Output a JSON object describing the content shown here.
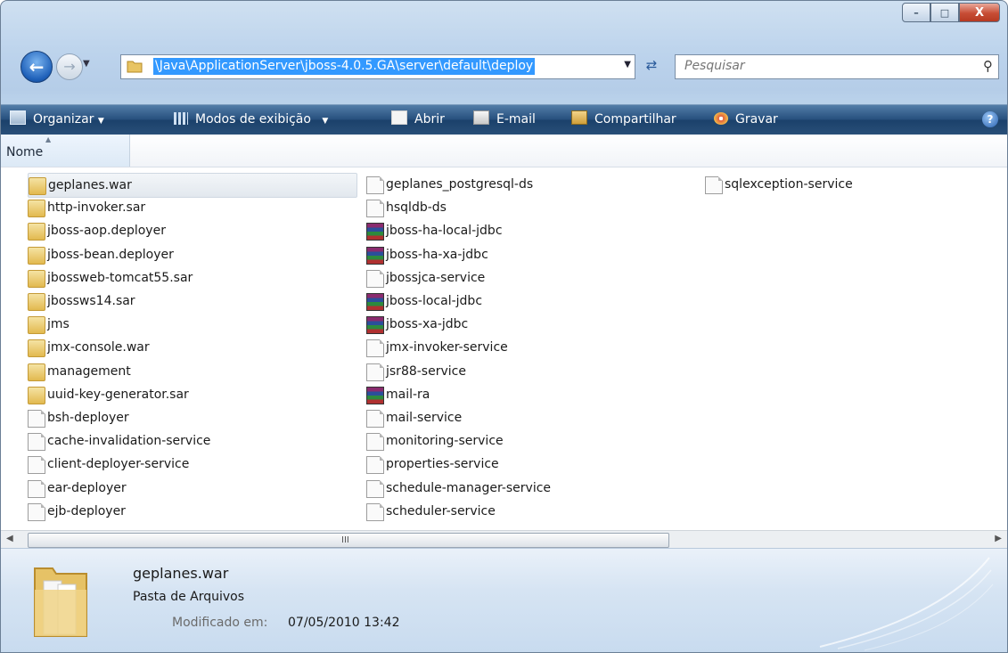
{
  "window": {
    "minimize_glyph": "–",
    "maximize_glyph": "□",
    "close_glyph": "X"
  },
  "address": {
    "path": "\\Java\\ApplicationServer\\jboss-4.0.5.GA\\server\\default\\deploy",
    "search_placeholder": "Pesquisar"
  },
  "toolbar": {
    "organizar": "Organizar",
    "modos": "Modos de exibição",
    "abrir": "Abrir",
    "email": "E-mail",
    "compartilhar": "Compartilhar",
    "gravar": "Gravar",
    "help": "?"
  },
  "columns": {
    "name": "Nome"
  },
  "files": {
    "col1": [
      {
        "name": "geplanes.war",
        "type": "folder"
      },
      {
        "name": "http-invoker.sar",
        "type": "folder"
      },
      {
        "name": "jboss-aop.deployer",
        "type": "folder"
      },
      {
        "name": "jboss-bean.deployer",
        "type": "folder"
      },
      {
        "name": "jbossweb-tomcat55.sar",
        "type": "folder"
      },
      {
        "name": "jbossws14.sar",
        "type": "folder"
      },
      {
        "name": "jms",
        "type": "folder"
      },
      {
        "name": "jmx-console.war",
        "type": "folder"
      },
      {
        "name": "management",
        "type": "folder"
      },
      {
        "name": "uuid-key-generator.sar",
        "type": "folder"
      },
      {
        "name": "bsh-deployer",
        "type": "file"
      },
      {
        "name": "cache-invalidation-service",
        "type": "file"
      },
      {
        "name": "client-deployer-service",
        "type": "file"
      },
      {
        "name": "ear-deployer",
        "type": "file"
      },
      {
        "name": "ejb-deployer",
        "type": "file"
      }
    ],
    "col2": [
      {
        "name": "geplanes_postgresql-ds",
        "type": "file"
      },
      {
        "name": "hsqldb-ds",
        "type": "file"
      },
      {
        "name": "jboss-ha-local-jdbc",
        "type": "archive"
      },
      {
        "name": "jboss-ha-xa-jdbc",
        "type": "archive"
      },
      {
        "name": "jbossjca-service",
        "type": "file"
      },
      {
        "name": "jboss-local-jdbc",
        "type": "archive"
      },
      {
        "name": "jboss-xa-jdbc",
        "type": "archive"
      },
      {
        "name": "jmx-invoker-service",
        "type": "file"
      },
      {
        "name": "jsr88-service",
        "type": "file"
      },
      {
        "name": "mail-ra",
        "type": "archive"
      },
      {
        "name": "mail-service",
        "type": "file"
      },
      {
        "name": "monitoring-service",
        "type": "file"
      },
      {
        "name": "properties-service",
        "type": "file"
      },
      {
        "name": "schedule-manager-service",
        "type": "file"
      },
      {
        "name": "scheduler-service",
        "type": "file"
      }
    ],
    "col3": [
      {
        "name": "sqlexception-service",
        "type": "file"
      }
    ]
  },
  "scrollbar": {
    "grip": "III"
  },
  "details": {
    "name": "geplanes.war",
    "type": "Pasta de Arquivos",
    "modified_label": "Modificado em:",
    "modified_value": "07/05/2010 13:42"
  }
}
